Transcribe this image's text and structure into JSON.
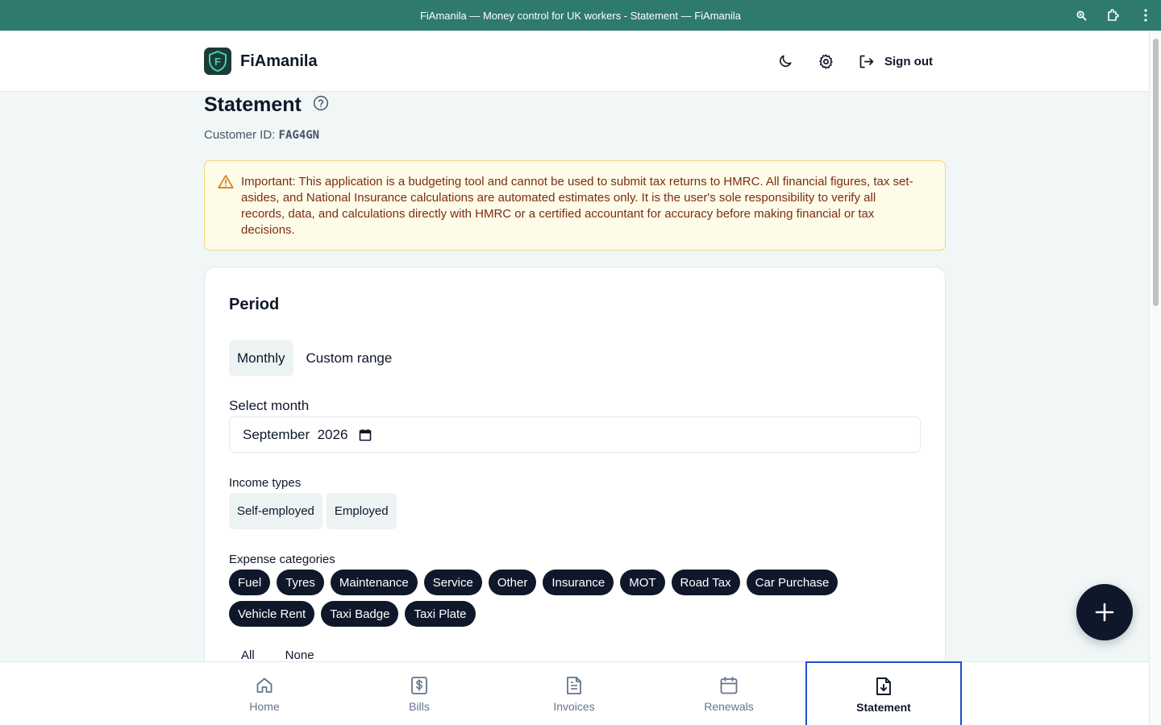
{
  "window": {
    "title": "FiAmanila — Money control for UK workers - Statement — FiAmanila"
  },
  "header": {
    "brand_name": "FiAmanila",
    "logo_letter": "F",
    "signout_label": "Sign out"
  },
  "page": {
    "title": "Statement",
    "customer_id_label": "Customer ID:",
    "customer_id": "FAG4GN"
  },
  "alert": {
    "text": "Important: This application is a budgeting tool and cannot be used to submit tax returns to HMRC. All financial figures, tax set-asides, and National Insurance calculations are automated estimates only. It is the user's sole responsibility to verify all records, data, and calculations directly with HMRC or a certified accountant for accuracy before making financial or tax decisions."
  },
  "period": {
    "title": "Period",
    "tabs": [
      {
        "label": "Monthly",
        "active": true
      },
      {
        "label": "Custom range",
        "active": false
      }
    ],
    "select_month_label": "Select month",
    "month_value": "September  2026",
    "income_label": "Income types",
    "income_types": [
      "Self-employed",
      "Employed"
    ],
    "expense_label": "Expense categories",
    "expense_categories": [
      "Fuel",
      "Tyres",
      "Maintenance",
      "Service",
      "Other",
      "Insurance",
      "MOT",
      "Road Tax",
      "Car Purchase",
      "Vehicle Rent",
      "Taxi Badge",
      "Taxi Plate"
    ],
    "select_all": "All",
    "select_none": "None"
  },
  "nav": {
    "items": [
      {
        "label": "Home",
        "icon": "home-icon"
      },
      {
        "label": "Bills",
        "icon": "bills-icon"
      },
      {
        "label": "Invoices",
        "icon": "invoice-icon"
      },
      {
        "label": "Renewals",
        "icon": "calendar-icon"
      },
      {
        "label": "Statement",
        "icon": "statement-download-icon",
        "active": true
      }
    ]
  },
  "colors": {
    "titlebar": "#2f7a6e",
    "background": "#f0f7f6",
    "chip_dark": "#0f172a",
    "alert_bg": "#fefbe9",
    "alert_text": "#7c2d12",
    "active_nav_border": "#1f4fd1"
  }
}
